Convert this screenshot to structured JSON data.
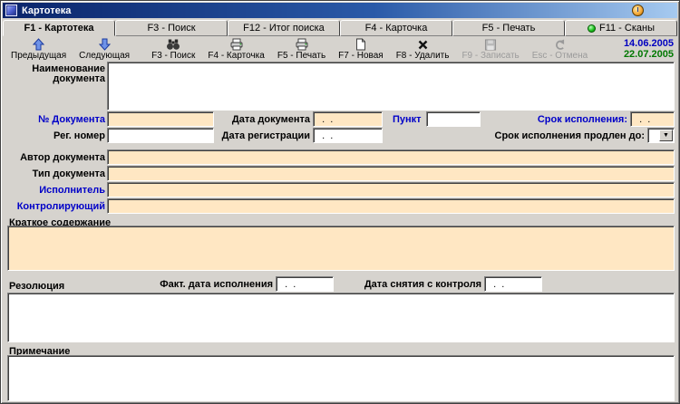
{
  "window": {
    "title": "Картотека",
    "date_top": "14.06.2005",
    "date_bottom": "22.07.2005"
  },
  "colors": {
    "highlight_field": "#ffe7c3",
    "label_blue": "#0000c8",
    "date_top": "#0000c0",
    "date_bottom": "#007800",
    "scan_led_green": "#21c421"
  },
  "tabs": [
    {
      "label": "F1 - Картотека",
      "active": true
    },
    {
      "label": "F3 - Поиск",
      "active": false
    },
    {
      "label": "F12 - Итог поиска",
      "active": false
    },
    {
      "label": "F4 - Карточка",
      "active": false
    },
    {
      "label": "F5 - Печать",
      "active": false
    },
    {
      "label": "F11 - Сканы",
      "active": false
    }
  ],
  "toolbar": {
    "prev": "Предыдущая",
    "next": "Следующая",
    "search": "F3 - Поиск",
    "card": "F4 - Карточка",
    "print": "F5 - Печать",
    "new": "F7 - Новая",
    "delete": "F8 - Удалить",
    "save": "F9 - Записать",
    "cancel": "Esc - Отмена"
  },
  "form": {
    "doc_name_label": "Наименование документа",
    "doc_number_label": "№ Документа",
    "doc_date_label": "Дата документа",
    "doc_date_value": "  .  .",
    "punkt_label": "Пункт",
    "deadline_label": "Срок исполнения:",
    "deadline_value": "  .  .",
    "reg_number_label": "Рег. номер",
    "reg_date_label": "Дата регистрации",
    "reg_date_value": "  .  .",
    "prolong_label": "Срок исполнения продлен до:",
    "author_label": "Автор документа",
    "doc_type_label": "Тип документа",
    "executor_label": "Исполнитель",
    "controller_label": "Контролирующий",
    "summary_label": "Краткое содержание",
    "fact_date_label": "Факт. дата исполнения",
    "fact_date_value": "  .  .",
    "off_control_label": "Дата снятия с контроля",
    "off_control_value": "  .  .",
    "resolution_label": "Резолюция",
    "note_label": "Примечание"
  }
}
